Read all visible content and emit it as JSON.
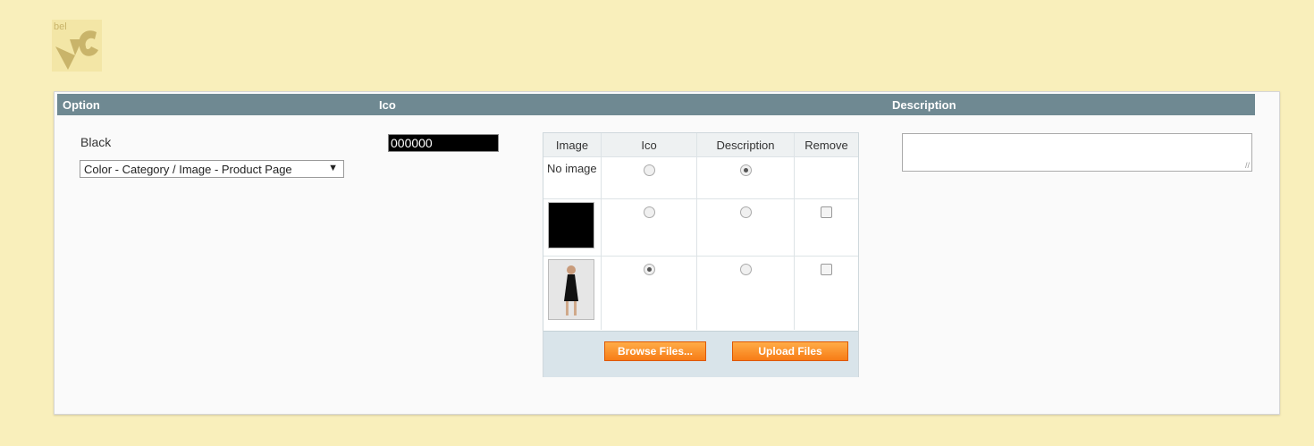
{
  "logo": {
    "text": "bel",
    "name": "brand-logo"
  },
  "header": {
    "option": "Option",
    "ico": "Ico",
    "description": "Description"
  },
  "option": {
    "name": "Black",
    "select_value": "Color - Category / Image - Product Page",
    "select_arrow": "▼"
  },
  "ico_input": {
    "value": "000000"
  },
  "images": {
    "columns": [
      "Image",
      "Ico",
      "Description",
      "Remove"
    ],
    "rows": [
      {
        "image_label": "No image",
        "ico_selected": false,
        "description_selected": true,
        "removable": false
      },
      {
        "image_label": "",
        "ico_selected": false,
        "description_selected": false,
        "removable": true
      },
      {
        "image_label": "",
        "ico_selected": true,
        "description_selected": false,
        "removable": true
      }
    ],
    "browse_label": "Browse Files...",
    "upload_label": "Upload Files"
  },
  "description": {
    "value": ""
  },
  "colors": {
    "background": "#f9efbb",
    "header": "#6f8992",
    "button": "#f7891f"
  }
}
